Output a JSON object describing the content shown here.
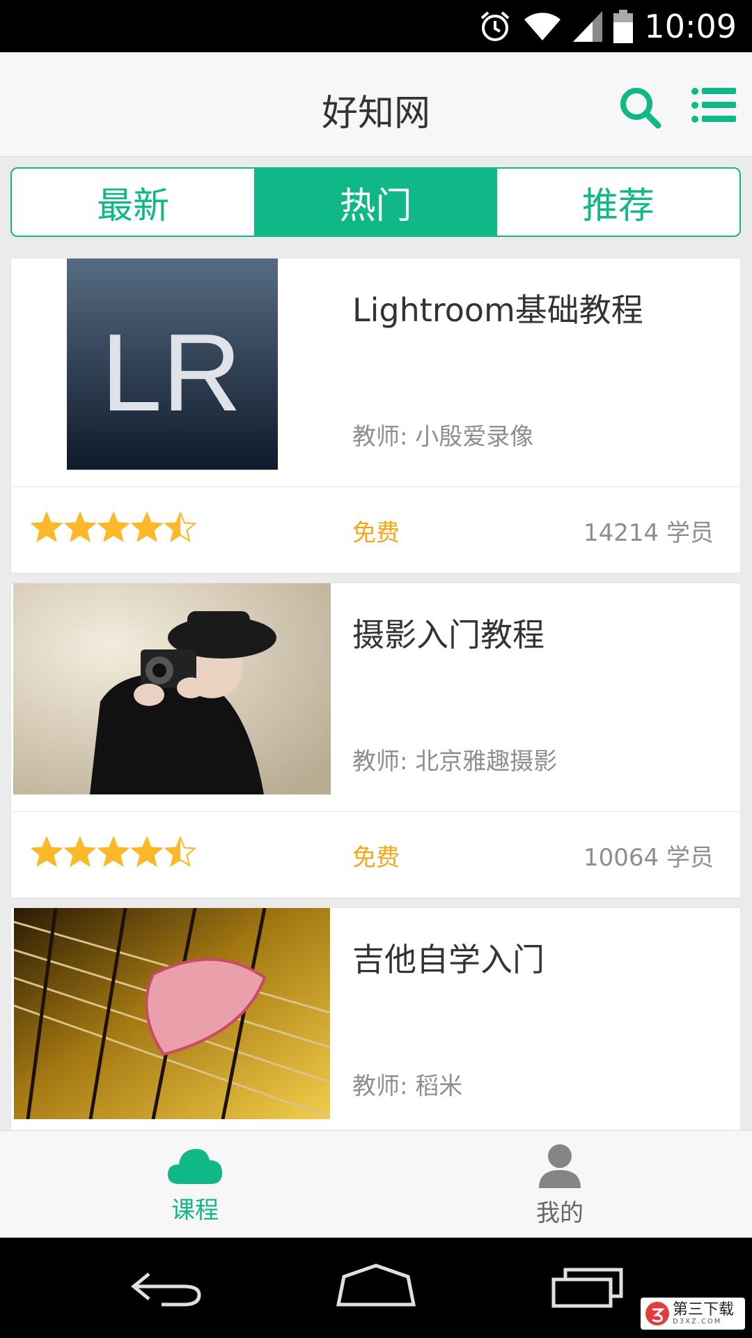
{
  "status_bar": {
    "time": "10:09",
    "icons": [
      "alarm-icon",
      "wifi-icon",
      "signal-icon",
      "battery-icon"
    ]
  },
  "app_bar": {
    "title": "好知网",
    "icons": [
      "search-icon",
      "list-menu-icon"
    ]
  },
  "tabs": [
    {
      "label": "最新",
      "active": false
    },
    {
      "label": "热门",
      "active": true
    },
    {
      "label": "推荐",
      "active": false
    }
  ],
  "courses": [
    {
      "title": "Lightroom基础教程",
      "teacher": "教师: 小殷爱录像",
      "rating": 4.5,
      "price": "免费",
      "students": "14214 学员",
      "thumb_text": "LR"
    },
    {
      "title": "摄影入门教程",
      "teacher": "教师: 北京雅趣摄影",
      "rating": 4.5,
      "price": "免费",
      "students": "10064 学员"
    },
    {
      "title": "吉他自学入门",
      "teacher": "教师: 稻米"
    }
  ],
  "bottom_nav": [
    {
      "label": "课程",
      "icon": "cloud-icon",
      "active": true
    },
    {
      "label": "我的",
      "icon": "person-icon",
      "active": false
    }
  ],
  "watermark": {
    "text": "第三下载",
    "sub": "D3XZ.COM"
  },
  "colors": {
    "accent": "#0fb886",
    "price": "#f2a71b",
    "star": "#fbb829",
    "muted": "#8e8e8e"
  }
}
